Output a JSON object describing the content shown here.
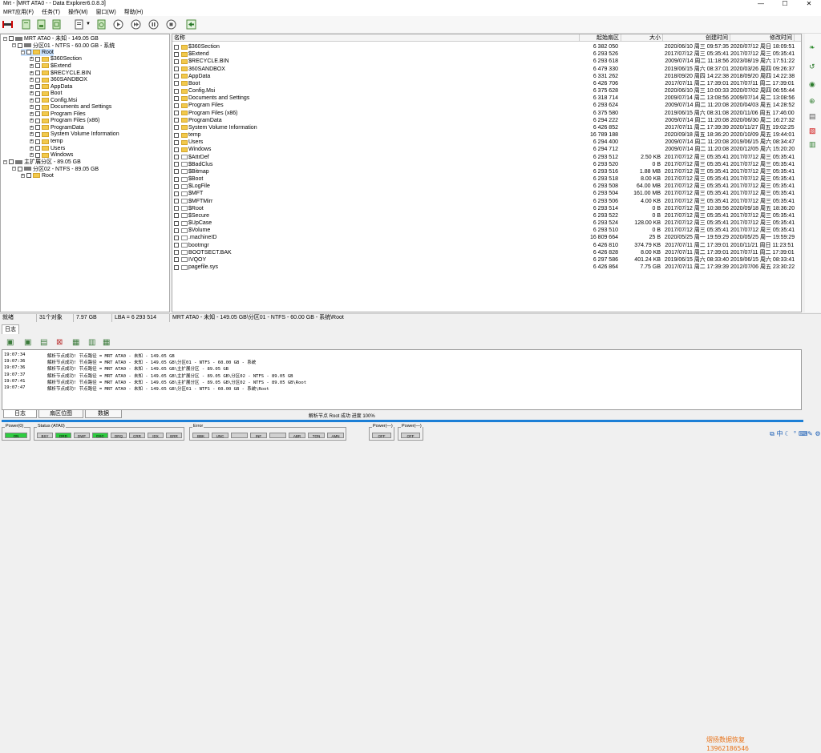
{
  "window": {
    "title": "Mrt - [MRT ATA0 -  - Data Explorer6.0.8.3]",
    "min": "—",
    "max": "☐",
    "close": "✕"
  },
  "menu": [
    "MRT应用(F)",
    "任务(T)",
    "操作(M)",
    "窗口(W)",
    "帮助(H)"
  ],
  "tree": [
    {
      "t": "MRT ATA0 - 未知 - 149.05 GB",
      "lvl": 0,
      "kind": "disk",
      "pm": "⊟"
    },
    {
      "t": "分区01 - NTFS - 60.00 GB - 系统",
      "lvl": 1,
      "kind": "part",
      "pm": "⊟"
    },
    {
      "t": "Root",
      "lvl": 2,
      "kind": "folder",
      "pm": "⊟",
      "sel": true
    },
    {
      "t": "$360Section",
      "lvl": 3,
      "kind": "folder",
      "pm": "⊞"
    },
    {
      "t": "$Extend",
      "lvl": 3,
      "kind": "folder",
      "pm": "⊞"
    },
    {
      "t": "$RECYCLE.BIN",
      "lvl": 3,
      "kind": "folder",
      "pm": "⊞"
    },
    {
      "t": "360SANDBOX",
      "lvl": 3,
      "kind": "folder",
      "pm": "⊞"
    },
    {
      "t": "AppData",
      "lvl": 3,
      "kind": "folder",
      "pm": "⊞"
    },
    {
      "t": "Boot",
      "lvl": 3,
      "kind": "folder",
      "pm": "⊞"
    },
    {
      "t": "Config.Msi",
      "lvl": 3,
      "kind": "folder",
      "pm": "⊞"
    },
    {
      "t": "Documents and Settings",
      "lvl": 3,
      "kind": "folder",
      "pm": "⊞"
    },
    {
      "t": "Program Files",
      "lvl": 3,
      "kind": "folder",
      "pm": "⊞"
    },
    {
      "t": "Program Files (x86)",
      "lvl": 3,
      "kind": "folder",
      "pm": "⊞"
    },
    {
      "t": "ProgramData",
      "lvl": 3,
      "kind": "folder",
      "pm": "⊞"
    },
    {
      "t": "System Volume Information",
      "lvl": 3,
      "kind": "folder",
      "pm": "⊞"
    },
    {
      "t": "temp",
      "lvl": 3,
      "kind": "folder",
      "pm": "⊞"
    },
    {
      "t": "Users",
      "lvl": 3,
      "kind": "folder",
      "pm": "⊞"
    },
    {
      "t": "Windows",
      "lvl": 3,
      "kind": "folder",
      "pm": "⊞"
    },
    {
      "t": "主扩展分区 - 89.05 GB",
      "lvl": 0,
      "kind": "part",
      "pm": "⊟"
    },
    {
      "t": "分区02 - NTFS - 89.05 GB",
      "lvl": 1,
      "kind": "part",
      "pm": "⊟"
    },
    {
      "t": "Root",
      "lvl": 2,
      "kind": "folder",
      "pm": "⊞"
    }
  ],
  "list": {
    "headers": [
      "名称",
      "起始扇区",
      "大小",
      "创建时间",
      "修改时间"
    ],
    "rows": [
      [
        "$360Section",
        "6 382 050",
        "",
        "2020/06/10 周三 09:57:35",
        "2020/07/12 周日 18:09:51",
        "folder"
      ],
      [
        "$Extend",
        "6 293 526",
        "",
        "2017/07/12 周三 05:35:41",
        "2017/07/12 周三 05:35:41",
        "folder"
      ],
      [
        "$RECYCLE.BIN",
        "6 293 618",
        "",
        "2009/07/14 周二 11:18:56",
        "2023/08/19 周六 17:51:22",
        "folder"
      ],
      [
        "360SANDBOX",
        "6 479 330",
        "",
        "2019/06/15 周六 08:37:01",
        "2020/03/26 周四 09:26:37",
        "folder"
      ],
      [
        "AppData",
        "6 331 262",
        "",
        "2018/09/20 周四 14:22:38",
        "2018/09/20 周四 14:22:38",
        "folder"
      ],
      [
        "Boot",
        "6 426 706",
        "",
        "2017/07/11 周二 17:39:01",
        "2017/07/11 周二 17:39:01",
        "folder"
      ],
      [
        "Config.Msi",
        "6 375 628",
        "",
        "2020/06/10 周三 10:00:33",
        "2020/07/02 周四 06:55:44",
        "folder"
      ],
      [
        "Documents and Settings",
        "6 318 714",
        "",
        "2009/07/14 周二 13:08:56",
        "2009/07/14 周二 13:08:56",
        "folder"
      ],
      [
        "Program Files",
        "6 293 624",
        "",
        "2009/07/14 周二 11:20:08",
        "2020/04/03 周五 14:28:52",
        "folder"
      ],
      [
        "Program Files (x86)",
        "6 375 580",
        "",
        "2019/06/15 周六 08:31:08",
        "2020/11/06 周五 17:46:00",
        "folder"
      ],
      [
        "ProgramData",
        "6 294 222",
        "",
        "2009/07/14 周二 11:20:08",
        "2020/06/30 周二 16:27:32",
        "folder"
      ],
      [
        "System Volume Information",
        "6 426 852",
        "",
        "2017/07/11 周二 17:39:39",
        "2020/11/27 周五 19:02:25",
        "folder"
      ],
      [
        "temp",
        "16 789 188",
        "",
        "2020/09/18 周五 18:36:20",
        "2020/10/09 周五 19:44:01",
        "folder"
      ],
      [
        "Users",
        "6 294 400",
        "",
        "2009/07/14 周二 11:20:08",
        "2019/06/15 周六 08:34:47",
        "folder"
      ],
      [
        "Windows",
        "6 294 712",
        "",
        "2009/07/14 周二 11:20:08",
        "2020/12/05 周六 15:20:20",
        "folder"
      ],
      [
        "$AttrDef",
        "6 293 512",
        "2.50 KB",
        "2017/07/12 周三 05:35:41",
        "2017/07/12 周三 05:35:41",
        "file"
      ],
      [
        "$BadClus",
        "6 293 520",
        "0 B",
        "2017/07/12 周三 05:35:41",
        "2017/07/12 周三 05:35:41",
        "file"
      ],
      [
        "$Bitmap",
        "6 293 516",
        "1.88 MB",
        "2017/07/12 周三 05:35:41",
        "2017/07/12 周三 05:35:41",
        "file"
      ],
      [
        "$Boot",
        "6 293 518",
        "8.00 KB",
        "2017/07/12 周三 05:35:41",
        "2017/07/12 周三 05:35:41",
        "file"
      ],
      [
        "$LogFile",
        "6 293 508",
        "64.00 MB",
        "2017/07/12 周三 05:35:41",
        "2017/07/12 周三 05:35:41",
        "file"
      ],
      [
        "$MFT",
        "6 293 504",
        "161.00 MB",
        "2017/07/12 周三 05:35:41",
        "2017/07/12 周三 05:35:41",
        "file"
      ],
      [
        "$MFTMirr",
        "6 293 506",
        "4.00 KB",
        "2017/07/12 周三 05:35:41",
        "2017/07/12 周三 05:35:41",
        "file"
      ],
      [
        "$Root",
        "6 293 514",
        "0 B",
        "2017/07/12 周三 10:38:56",
        "2020/09/18 周五 18:36:20",
        "file"
      ],
      [
        "$Secure",
        "6 293 522",
        "0 B",
        "2017/07/12 周三 05:35:41",
        "2017/07/12 周三 05:35:41",
        "file"
      ],
      [
        "$UpCase",
        "6 293 524",
        "128.00 KB",
        "2017/07/12 周三 05:35:41",
        "2017/07/12 周三 05:35:41",
        "file"
      ],
      [
        "$Volume",
        "6 293 510",
        "0 B",
        "2017/07/12 周三 05:35:41",
        "2017/07/12 周三 05:35:41",
        "file"
      ],
      [
        ".machineID",
        "16 809 664",
        "25 B",
        "2020/05/25 周一 19:59:29",
        "2020/05/25 周一 19:59:29",
        "file"
      ],
      [
        "bootmgr",
        "6 426 810",
        "374.79 KB",
        "2017/07/11 周二 17:39:01",
        "2010/11/21 周日 11:23:51",
        "file"
      ],
      [
        "BOOTSECT.BAK",
        "6 426 828",
        "8.00 KB",
        "2017/07/11 周二 17:39:01",
        "2017/07/11 周二 17:39:01",
        "file"
      ],
      [
        "IVQOY",
        "6 297 586",
        "401.24 KB",
        "2019/06/15 周六 08:33:40",
        "2019/06/15 周六 08:33:41",
        "file"
      ],
      [
        "pagefile.sys",
        "6 426 864",
        "7.75 GB",
        "2017/07/11 周二 17:39:39",
        "2012/07/06 周五 23:30:22",
        "file"
      ]
    ]
  },
  "status": [
    "就绪",
    "31个对象",
    "7.97 GB",
    "LBA = 6 293 514",
    "MRT ATA0 - 未知 - 149.05 GB\\分区01 - NTFS - 60.00 GB - 系统\\Root"
  ],
  "log": {
    "tab": "日志",
    "entries": [
      [
        "19:07:34",
        "解析节点成功! 节点路径 = MRT ATA0 - 未知 - 149.05 GB"
      ],
      [
        "19:07:36",
        "解析节点成功! 节点路径 = MRT ATA0 - 未知 - 149.05 GB\\分区01 - NTFS - 60.00 GB - 系统"
      ],
      [
        "19:07:36",
        "解析节点成功! 节点路径 = MRT ATA0 - 未知 - 149.05 GB\\主扩展分区 - 89.05 GB"
      ],
      [
        "19:07:37",
        "解析节点成功! 节点路径 = MRT ATA0 - 未知 - 149.05 GB\\主扩展分区 - 89.05 GB\\分区02 - NTFS - 89.05 GB"
      ],
      [
        "19:07:41",
        "解析节点成功! 节点路径 = MRT ATA0 - 未知 - 149.05 GB\\主扩展分区 - 89.05 GB\\分区02 - NTFS - 89.05 GB\\Root"
      ],
      [
        "19:07:47",
        "解析节点成功! 节点路径 = MRT ATA0 - 未知 - 149.05 GB\\分区01 - NTFS - 60.00 GB - 系统\\Root"
      ]
    ]
  },
  "watermark": {
    "line1": "熠扬数据恢复",
    "line2": "13962186546"
  },
  "bottom_tabs": [
    "日志",
    "扇区位图",
    "数据"
  ],
  "progress": {
    "text": "解析节点 Root 成功  进度 100%",
    "value": 1.0
  },
  "panels": {
    "power0": {
      "title": "Power(0)",
      "leds": [
        [
          "ON",
          true
        ]
      ]
    },
    "status": {
      "title": "Status (ATA0)",
      "leds": [
        [
          "BSY",
          false
        ],
        [
          "DRD",
          true
        ],
        [
          "DWF",
          false
        ],
        [
          "DSC",
          true
        ],
        [
          "DRQ",
          false
        ],
        [
          "CRR",
          false
        ],
        [
          "IDX",
          false
        ],
        [
          "ERR",
          false
        ]
      ]
    },
    "error": {
      "title": "Error",
      "leds": [
        [
          "BBK",
          false
        ],
        [
          "UNC",
          false
        ],
        [
          "",
          false
        ],
        [
          "INF",
          false
        ],
        [
          "",
          false
        ],
        [
          "ABR",
          false
        ],
        [
          "TON",
          false
        ],
        [
          "AMN",
          false
        ]
      ]
    },
    "power1": {
      "title": "Power(—)",
      "leds": [
        [
          "OFF",
          false
        ]
      ]
    },
    "power2": {
      "title": "Power(—)",
      "leds": [
        [
          "OFF",
          false
        ]
      ]
    }
  },
  "tray": [
    "⧉",
    "中",
    "☾",
    "°",
    "⌨",
    "✎",
    "⚙"
  ]
}
